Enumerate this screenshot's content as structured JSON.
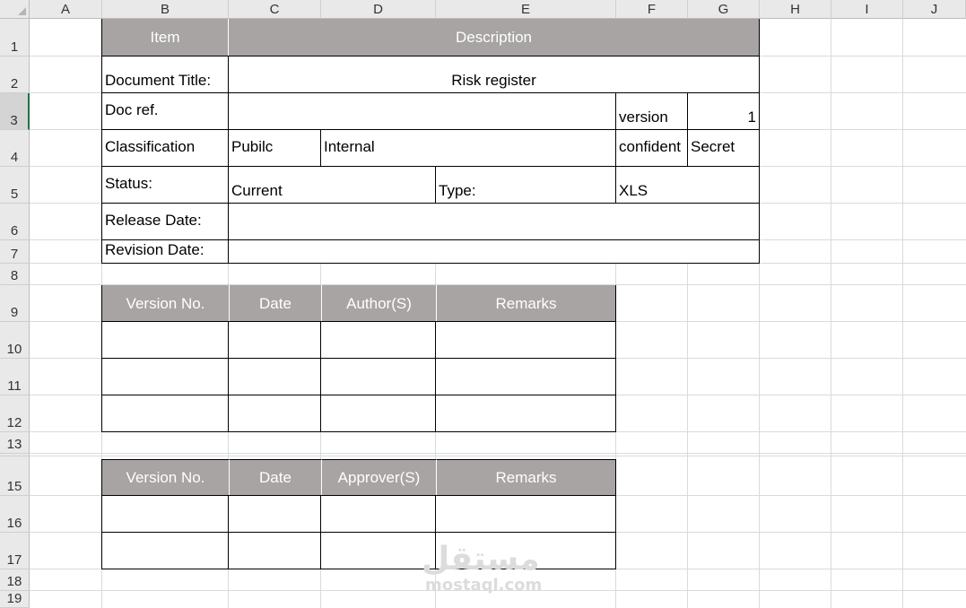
{
  "columns": [
    "A",
    "B",
    "C",
    "D",
    "E",
    "F",
    "G",
    "H",
    "I",
    "J"
  ],
  "rows": [
    "1",
    "2",
    "3",
    "4",
    "5",
    "6",
    "7",
    "8",
    "9",
    "10",
    "11",
    "12",
    "13",
    "15",
    "16",
    "17",
    "18",
    "19"
  ],
  "document_info": {
    "item_header": "Item",
    "description_header": "Description",
    "doc_title_label": "Document Title:",
    "doc_title_value": "Risk register",
    "doc_ref_label": "Doc ref.",
    "version_label": "version",
    "version_value": "1",
    "classification_label": "Classification",
    "class_public": "Pubilc",
    "class_internal": "Internal",
    "class_confidential": "confident",
    "class_secret": "Secret",
    "status_label": "Status:",
    "status_value": "Current",
    "type_label": "Type:",
    "type_value": "XLS",
    "release_date_label": "Release Date:",
    "revision_date_label": "Revision Date:"
  },
  "version_table": {
    "headers": [
      "Version No.",
      "Date",
      "Author(S)",
      "Remarks"
    ]
  },
  "approval_table": {
    "headers": [
      "Version No.",
      "Date",
      "Approver(S)",
      "Remarks"
    ]
  },
  "watermark": {
    "arabic": "مستقل",
    "latin": "mostaql.com"
  }
}
